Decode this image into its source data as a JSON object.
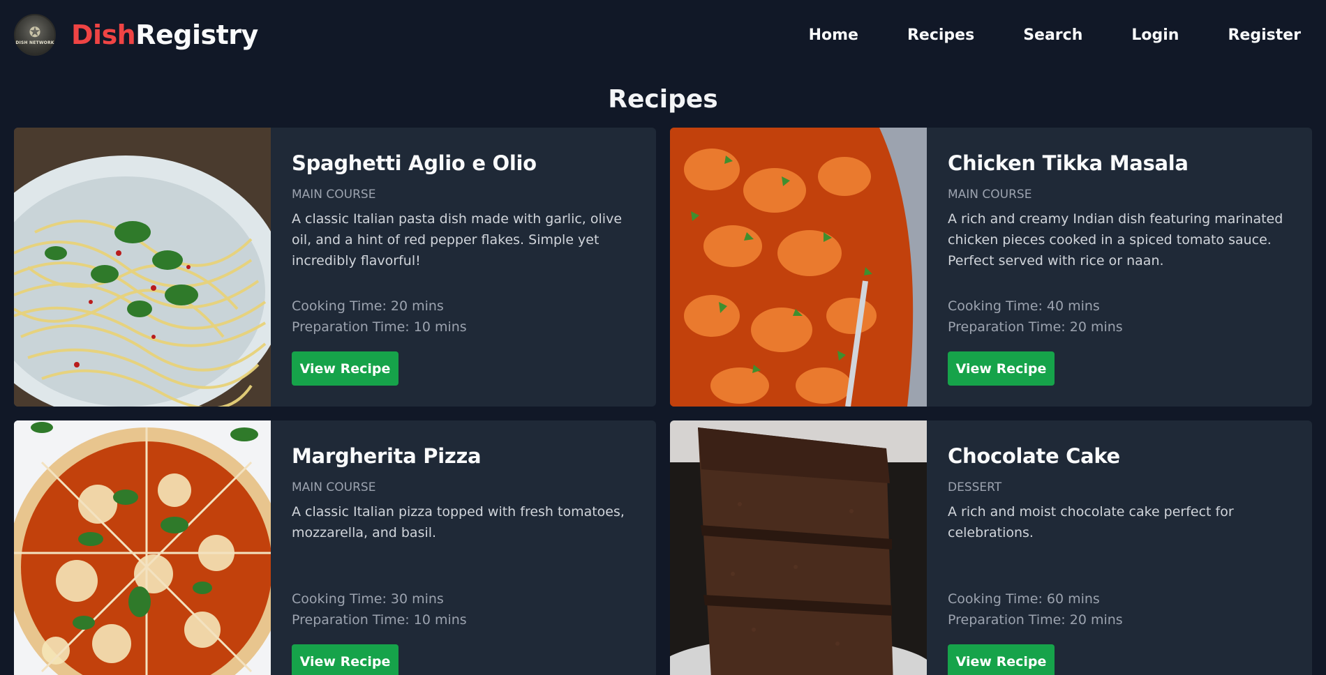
{
  "brand": {
    "logo_text": "DISH NETWORK",
    "name_part1": "Dish",
    "name_part2": "Registry"
  },
  "nav": {
    "home": "Home",
    "recipes": "Recipes",
    "search": "Search",
    "login": "Login",
    "register": "Register"
  },
  "page": {
    "title": "Recipes"
  },
  "recipes": [
    {
      "title": "Spaghetti Aglio e Olio",
      "category": "MAIN COURSE",
      "description": "A classic Italian pasta dish made with garlic, olive oil, and a hint of red pepper flakes. Simple yet incredibly flavorful!",
      "cooking_time": "Cooking Time: 20 mins",
      "prep_time": "Preparation Time: 10 mins",
      "button": "View Recipe"
    },
    {
      "title": "Chicken Tikka Masala",
      "category": "MAIN COURSE",
      "description": "A rich and creamy Indian dish featuring marinated chicken pieces cooked in a spiced tomato sauce. Perfect served with rice or naan.",
      "cooking_time": "Cooking Time: 40 mins",
      "prep_time": "Preparation Time: 20 mins",
      "button": "View Recipe"
    },
    {
      "title": "Margherita Pizza",
      "category": "MAIN COURSE",
      "description": "A classic Italian pizza topped with fresh tomatoes, mozzarella, and basil.",
      "cooking_time": "Cooking Time: 30 mins",
      "prep_time": "Preparation Time: 10 mins",
      "button": "View Recipe"
    },
    {
      "title": "Chocolate Cake",
      "category": "DESSERT",
      "description": "A rich and moist chocolate cake perfect for celebrations.",
      "cooking_time": "Cooking Time: 60 mins",
      "prep_time": "Preparation Time: 20 mins",
      "button": "View Recipe"
    }
  ],
  "colors": {
    "background": "#111827",
    "card": "#1f2937",
    "accent_red": "#ef4444",
    "button_green": "#16a34a"
  }
}
